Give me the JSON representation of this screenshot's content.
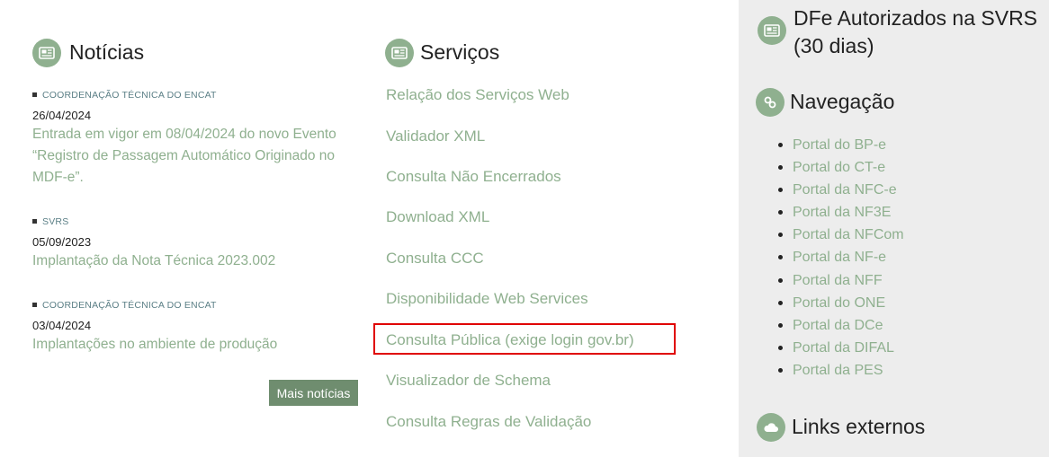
{
  "noticias": {
    "title": "Notícias",
    "items": [
      {
        "category": "COORDENAÇÃO TÉCNICA DO ENCAT",
        "date": "26/04/2024",
        "text": "Entrada em vigor em 08/04/2024 do novo Evento “Registro de Passagem Automático Originado no MDF-e”."
      },
      {
        "category": "SVRS",
        "date": "05/09/2023",
        "text": "Implantação da Nota Técnica 2023.002"
      },
      {
        "category": "COORDENAÇÃO TÉCNICA DO ENCAT",
        "date": "03/04/2024",
        "text": "Implantações no ambiente de produção"
      }
    ],
    "more_label": "Mais notícias"
  },
  "servicos": {
    "title": "Serviços",
    "items": [
      "Relação dos Serviços Web",
      "Validador XML",
      "Consulta Não Encerrados",
      "Download XML",
      "Consulta CCC",
      "Disponibilidade Web Services",
      "Consulta Pública (exige login gov.br)",
      "Visualizador de Schema",
      "Consulta Regras de Validação"
    ]
  },
  "sidebar": {
    "dfe_title_line1": "DFe Autorizados na SVRS",
    "dfe_title_line2": "(30 dias)",
    "nav_title": "Navegação",
    "nav_items": [
      "Portal do BP-e",
      "Portal do CT-e",
      "Portal da NFC-e",
      "Portal da NF3E",
      "Portal da NFCom",
      "Portal da NF-e",
      "Portal da NFF",
      "Portal do ONE",
      "Portal da DCe",
      "Portal da DIFAL",
      "Portal da PES"
    ],
    "links_title": "Links externos"
  },
  "icons": {
    "noticias": "newspaper-icon",
    "servicos": "newspaper-icon",
    "dfe": "newspaper-icon",
    "navegacao": "link-icon",
    "links": "cloud-icon"
  },
  "colors": {
    "accent": "#8fb08f",
    "button": "#6f8d6f",
    "highlight": "#e00000",
    "sidebar_bg": "#ededed"
  }
}
